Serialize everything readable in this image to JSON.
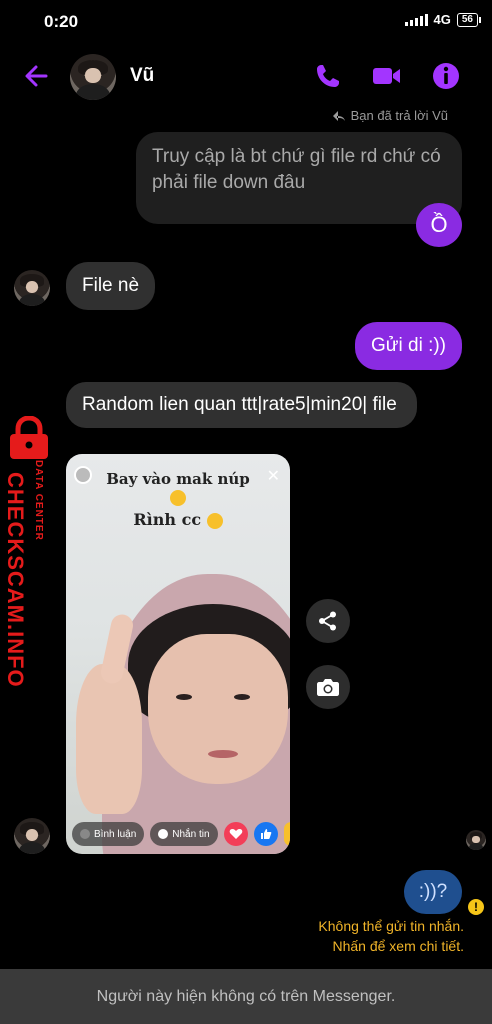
{
  "status_bar": {
    "time": "0:20",
    "network": "4G",
    "battery": "56"
  },
  "header": {
    "contact_name": "Vũ"
  },
  "colors": {
    "accent": "#a335ff",
    "sent_bubble": "#8a2be2",
    "received_bubble": "#303030",
    "error": "#f0b429",
    "watermark": "#e51b1b"
  },
  "reply_info": "Bạn đã trả lời Vũ",
  "messages": {
    "quoted": "Truy cập là bt chứ gì file rd chứ có phải file down đâu",
    "reply_sent": "Ồ",
    "file_ne": "File nè",
    "gui_di": "Gửi di :))",
    "random": "Random lien quan ttt|rate5|min20| file",
    "failed": ":))?"
  },
  "story": {
    "caption_line1": "Bay vào mak núp",
    "caption_line2": "Rình cc",
    "comment_label": "Bình luận",
    "message_label": "Nhắn tin"
  },
  "error": {
    "line1": "Không thể gửi tin nhắn.",
    "line2": "Nhấn để xem chi tiết."
  },
  "footer": "Người này hiện không có trên Messenger.",
  "watermark": {
    "brand": "CHECKSCAM.INFO",
    "sub": "DATA CENTER"
  },
  "icons": [
    "back-arrow-icon",
    "phone-icon",
    "video-camera-icon",
    "info-icon",
    "reply-arrow-icon",
    "share-icon",
    "camera-icon",
    "heart-icon",
    "like-icon",
    "warning-icon"
  ]
}
